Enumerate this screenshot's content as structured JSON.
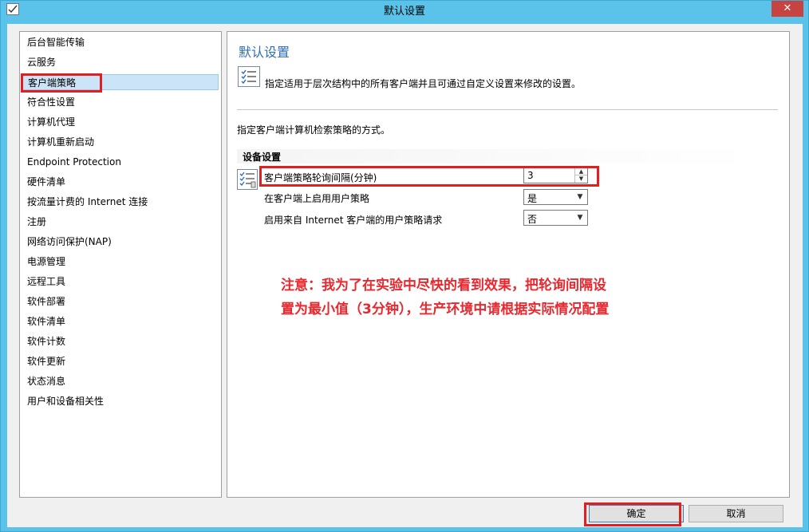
{
  "window": {
    "title": "默认设置",
    "close_glyph": "✕"
  },
  "nav": {
    "items": [
      {
        "label": "后台智能传输",
        "selected": false
      },
      {
        "label": "云服务",
        "selected": false
      },
      {
        "label": "客户端策略",
        "selected": true
      },
      {
        "label": "符合性设置",
        "selected": false
      },
      {
        "label": "计算机代理",
        "selected": false
      },
      {
        "label": "计算机重新启动",
        "selected": false
      },
      {
        "label": "Endpoint Protection",
        "selected": false
      },
      {
        "label": "硬件清单",
        "selected": false
      },
      {
        "label": "按流量计费的 Internet 连接",
        "selected": false
      },
      {
        "label": "注册",
        "selected": false
      },
      {
        "label": "网络访问保护(NAP)",
        "selected": false
      },
      {
        "label": "电源管理",
        "selected": false
      },
      {
        "label": "远程工具",
        "selected": false
      },
      {
        "label": "软件部署",
        "selected": false
      },
      {
        "label": "软件清单",
        "selected": false
      },
      {
        "label": "软件计数",
        "selected": false
      },
      {
        "label": "软件更新",
        "selected": false
      },
      {
        "label": "状态消息",
        "selected": false
      },
      {
        "label": "用户和设备相关性",
        "selected": false
      }
    ]
  },
  "panel": {
    "title": "默认设置",
    "description": "指定适用于层次结构中的所有客户端并且可通过自定义设置来修改的设置。",
    "hint": "指定客户端计算机检索策略的方式。",
    "group_label": "设备设置",
    "settings": {
      "polling_interval": {
        "label": "客户端策略轮询间隔(分钟)",
        "value": "3"
      },
      "enable_user_policy": {
        "label": "在客户端上启用用户策略",
        "value": "是"
      },
      "internet_user_policy": {
        "label": "启用来自 Internet 客户端的用户策略请求",
        "value": "否"
      }
    },
    "note": "注意：我为了在实验中尽快的看到效果，把轮询间隔设置为最小值（3分钟），生产环境中请根据实际情况配置"
  },
  "buttons": {
    "ok": "确定",
    "cancel": "取消"
  },
  "colors": {
    "accent_title": "#2e6db0",
    "highlight_red": "#e02020",
    "note_red": "#e8282e",
    "frame": "#5bc3ea"
  }
}
